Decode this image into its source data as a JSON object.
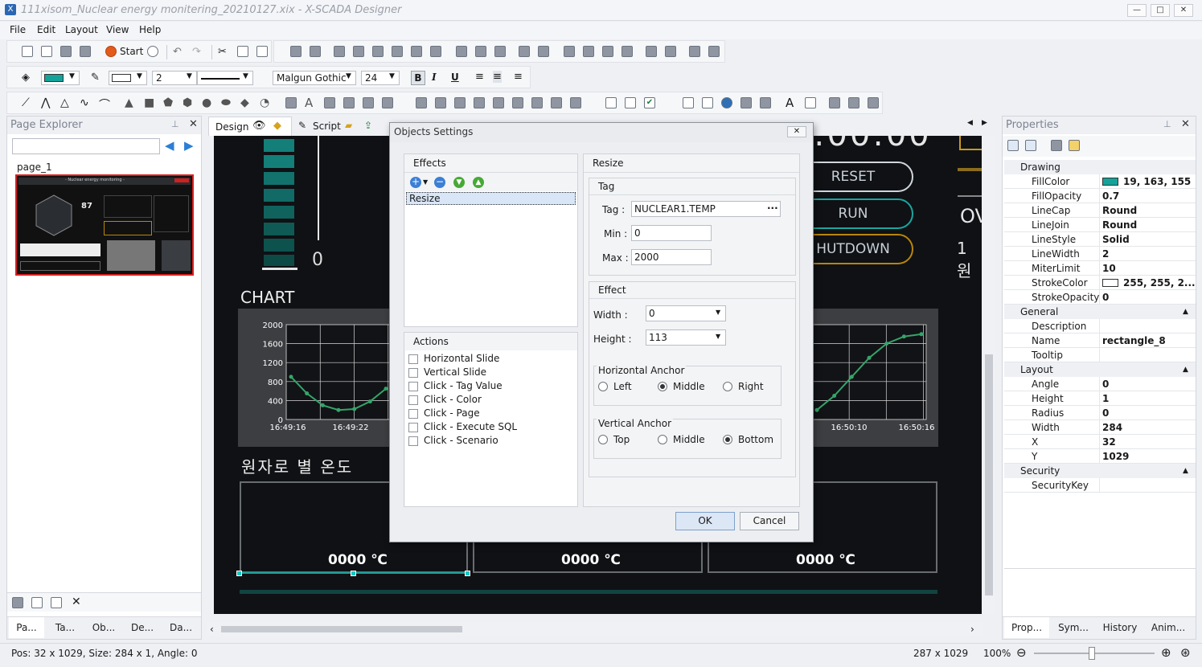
{
  "window": {
    "title": "111xisom_Nuclear energy monitering_20210127.xix - X-SCADA Designer"
  },
  "menu": [
    "File",
    "Edit",
    "Layout",
    "View",
    "Help"
  ],
  "toolbar": {
    "start_label": "Start",
    "fill_color": "#13a39b",
    "line_width": "2",
    "font_family": "Malgun Gothic",
    "font_size": "24"
  },
  "page_explorer": {
    "title": "Page Explorer",
    "search_value": "",
    "page_label": "page_1",
    "thumb_text": "- Nuclear energy monitoring -",
    "thumb_value": "87",
    "bottom_tabs": [
      "Pa...",
      "Ta...",
      "Ob...",
      "De...",
      "Da..."
    ]
  },
  "editor_tabs": {
    "design": "Design",
    "script": "Script"
  },
  "canvas": {
    "chart_label": "CHART",
    "gauge_value": "0",
    "clock_partial": ":00:00",
    "buttons": {
      "reset": "RESET",
      "run": "RUN",
      "shutdown": "HUTDOWN"
    },
    "right_partial_1": "OV",
    "right_partial_2": "1원",
    "korean_label": "원자로 별 온도",
    "temps": [
      "0000 ℃",
      "0000 ℃",
      "0000 ℃"
    ],
    "left_chart": {
      "yticks": [
        "2000",
        "1600",
        "1200",
        "800",
        "400",
        "0"
      ],
      "xticks": [
        "16:49:16",
        "16:49:22"
      ]
    },
    "right_chart": {
      "xticks": [
        "16:50:10",
        "16:50:16"
      ]
    }
  },
  "chart_data": [
    {
      "type": "line",
      "title": "",
      "xlabel": "",
      "ylabel": "",
      "ylim": [
        0,
        2000
      ],
      "x": [
        "16:49:16",
        "16:49:22"
      ],
      "series": [
        {
          "values": [
            900,
            550,
            300,
            200,
            220,
            380,
            650
          ]
        }
      ]
    },
    {
      "type": "line",
      "title": "",
      "xlabel": "",
      "ylabel": "",
      "x": [
        "16:50:10",
        "16:50:16"
      ],
      "series": [
        {
          "values": [
            200,
            500,
            900,
            1300,
            1600,
            1750,
            1800
          ]
        }
      ]
    }
  ],
  "dialog": {
    "title": "Objects Settings",
    "effects_title": "Effects",
    "effects_items": [
      "Resize"
    ],
    "actions_title": "Actions",
    "actions": [
      "Horizontal Slide",
      "Vertical Slide",
      "Click - Tag Value",
      "Click - Color",
      "Click - Page",
      "Click - Execute SQL",
      "Click - Scenario"
    ],
    "resize_title": "Resize",
    "tag_group": "Tag",
    "tag_label": "Tag :",
    "tag_value": "NUCLEAR1.TEMP",
    "min_label": "Min :",
    "min_value": "0",
    "max_label": "Max :",
    "max_value": "2000",
    "effect_group": "Effect",
    "width_label": "Width :",
    "width_value": "0",
    "height_label": "Height :",
    "height_value": "113",
    "h_anchor": "Horizontal Anchor",
    "h_opts": [
      "Left",
      "Middle",
      "Right"
    ],
    "v_anchor": "Vertical Anchor",
    "v_opts": [
      "Top",
      "Middle",
      "Bottom"
    ],
    "ok": "OK",
    "cancel": "Cancel"
  },
  "properties": {
    "title": "Properties",
    "categories": {
      "drawing": "Drawing",
      "general": "General",
      "layout": "Layout",
      "security": "Security"
    },
    "drawing": [
      {
        "k": "FillColor",
        "v": "19, 163, 155"
      },
      {
        "k": "FillOpacity",
        "v": "0.7"
      },
      {
        "k": "LineCap",
        "v": "Round"
      },
      {
        "k": "LineJoin",
        "v": "Round"
      },
      {
        "k": "LineStyle",
        "v": "Solid"
      },
      {
        "k": "LineWidth",
        "v": "2"
      },
      {
        "k": "MiterLimit",
        "v": "10"
      },
      {
        "k": "StrokeColor",
        "v": "255, 255, 2..."
      },
      {
        "k": "StrokeOpacity",
        "v": "0"
      }
    ],
    "general": [
      {
        "k": "Description",
        "v": ""
      },
      {
        "k": "Name",
        "v": "rectangle_8"
      },
      {
        "k": "Tooltip",
        "v": ""
      }
    ],
    "layout": [
      {
        "k": "Angle",
        "v": "0"
      },
      {
        "k": "Height",
        "v": "1"
      },
      {
        "k": "Radius",
        "v": "0"
      },
      {
        "k": "Width",
        "v": "284"
      },
      {
        "k": "X",
        "v": "32"
      },
      {
        "k": "Y",
        "v": "1029"
      }
    ],
    "security": [
      {
        "k": "SecurityKey",
        "v": ""
      }
    ],
    "bottom_tabs": [
      "Prop...",
      "Sym...",
      "History",
      "Anim..."
    ]
  },
  "status": {
    "left": "Pos: 32 x 1029, Size: 284 x 1, Angle: 0",
    "size": "287 x 1029",
    "zoom": "100%"
  }
}
